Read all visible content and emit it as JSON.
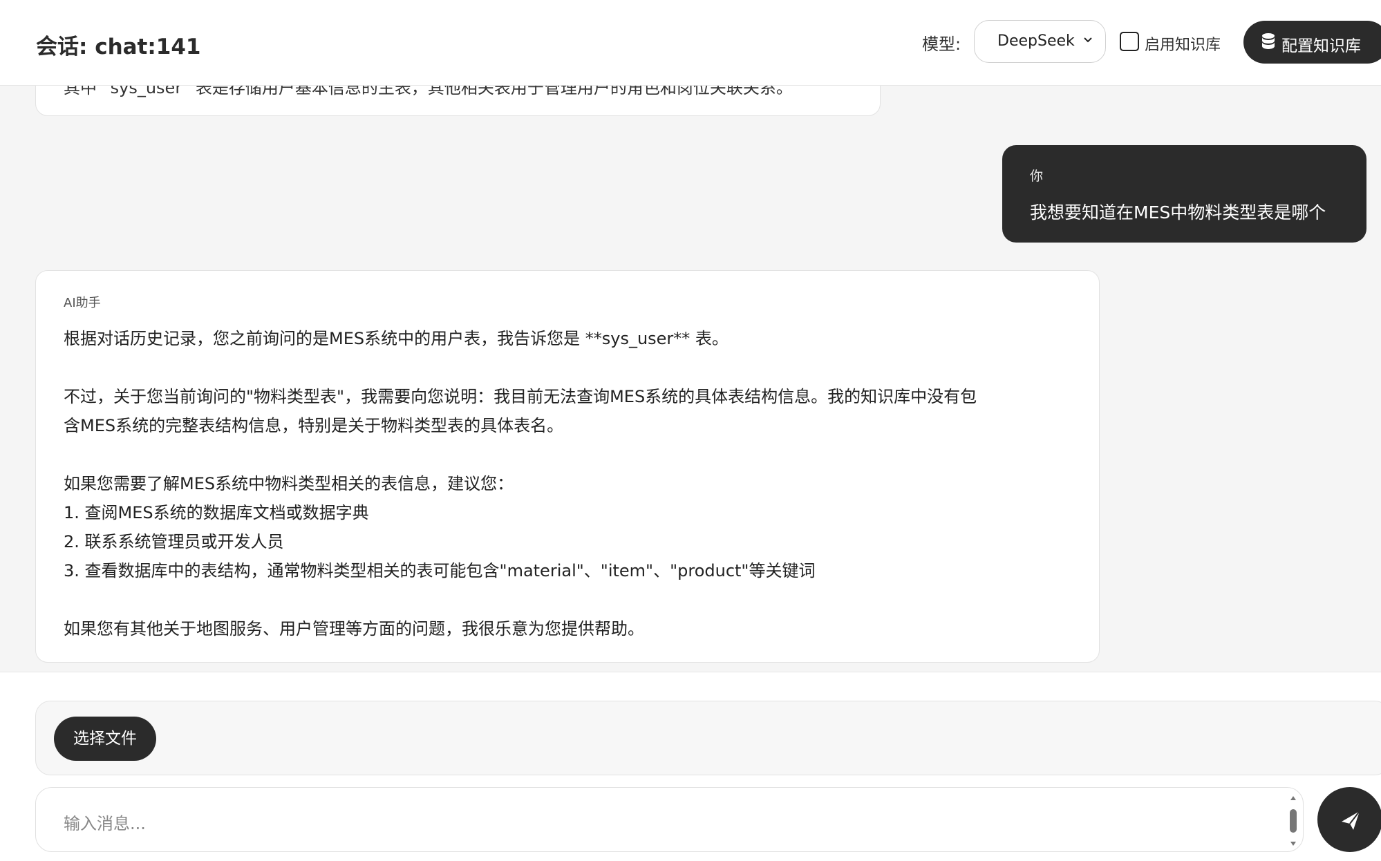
{
  "header": {
    "title": "会话: chat:141",
    "model_label": "模型:",
    "model_value": "DeepSeek",
    "kb_toggle_label": "启用知识库",
    "config_kb_label": "配置知识库"
  },
  "chat": {
    "prev_fragment": "其中 `sys_user` 表是存储用户基本信息的主表，其他相关表用于管理用户的角色和岗位关联关系。",
    "user_message": {
      "sender": "你",
      "text": "我想要知道在MES中物料类型表是哪个"
    },
    "ai_message": {
      "sender": "AI助手",
      "lines": [
        "根据对话历史记录，您之前询问的是MES系统中的用户表，我告诉您是 **sys_user** 表。",
        "不过，关于您当前询问的\"物料类型表\"，我需要向您说明：我目前无法查询MES系统的具体表结构信息。我的知识库中没有包",
        "含MES系统的完整表结构信息，特别是关于物料类型表的具体表名。",
        "如果您需要了解MES系统中物料类型相关的表信息，建议您：",
        "1. 查阅MES系统的数据库文档或数据字典",
        "2. 联系系统管理员或开发人员",
        "3. 查看数据库中的表结构，通常物料类型相关的表可能包含\"material\"、\"item\"、\"product\"等关键词",
        "如果您有其他关于地图服务、用户管理等方面的问题，我很乐意为您提供帮助。"
      ]
    }
  },
  "composer": {
    "choose_file_label": "选择文件",
    "input_placeholder": "输入消息...",
    "input_value": ""
  },
  "icons": {
    "model_chevron": "chevron-down-icon",
    "kb_config": "database-icon",
    "send": "send-icon"
  },
  "colors": {
    "accent": "#2b2b2b",
    "background": "#f5f5f5",
    "surface": "#ffffff"
  }
}
